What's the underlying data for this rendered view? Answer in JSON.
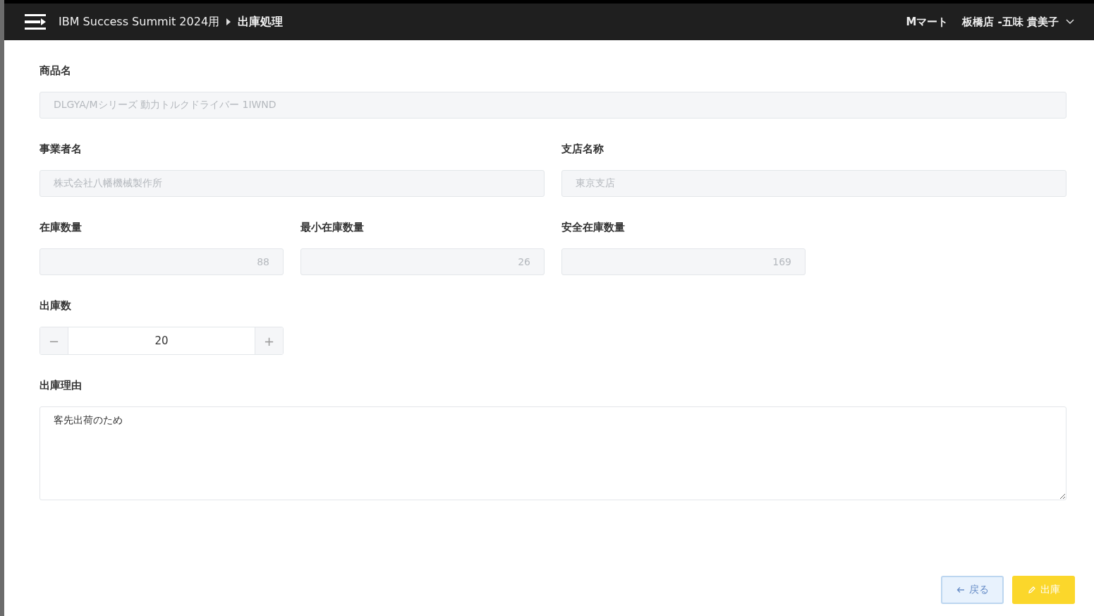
{
  "header": {
    "breadcrumb": [
      {
        "label": "IBM Success Summit 2024用"
      },
      {
        "label": "出庫処理"
      }
    ],
    "store": "Mマート",
    "user": "板橋店 -五味 貴美子"
  },
  "rows": [
    [
      {
        "kind": "text",
        "label": "商品名",
        "value": "DLGYA/Mシリーズ 動力トルクドライバー 1IWND",
        "disabled": true
      }
    ],
    [
      {
        "kind": "text",
        "label": "事業者名",
        "value": "株式会社八幡機械製作所",
        "disabled": true
      },
      {
        "kind": "text",
        "label": "支店名称",
        "value": "東京支店",
        "disabled": true
      }
    ],
    [
      {
        "kind": "number",
        "label": "在庫数量",
        "value": "88",
        "disabled": true
      },
      {
        "kind": "number",
        "label": "最小在庫数量",
        "value": "26",
        "disabled": true
      },
      {
        "kind": "number",
        "label": "安全在庫数量",
        "value": "169",
        "disabled": true
      }
    ],
    [
      {
        "kind": "stepper",
        "label": "出庫数",
        "value": "20",
        "minus": "−",
        "plus": "+",
        "disabled": false
      }
    ],
    [
      {
        "kind": "textarea",
        "label": "出庫理由",
        "value": "客先出荷のため",
        "disabled": false
      }
    ]
  ],
  "buttons": [
    {
      "kind": "secondary",
      "label": "戻る"
    },
    {
      "kind": "primary",
      "label": "出庫"
    }
  ]
}
